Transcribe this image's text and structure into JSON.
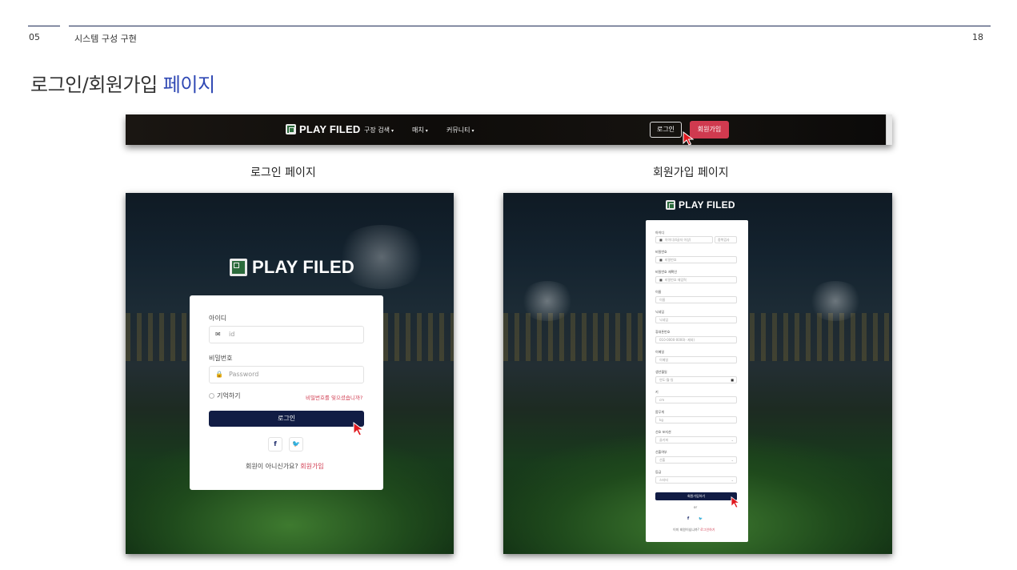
{
  "header": {
    "section_number": "05",
    "section_title": "시스템 구성 구현",
    "page_number": "18"
  },
  "title": {
    "main": "로그인/회원가입",
    "accent": "페이지"
  },
  "navbar": {
    "brand": "PLAY FILED",
    "items": [
      {
        "label": "구장 검색"
      },
      {
        "label": "매치"
      },
      {
        "label": "커뮤니티"
      }
    ],
    "login_label": "로그인",
    "signup_label": "회원가입"
  },
  "captions": {
    "login": "로그인 페이지",
    "signup": "회원가입 페이지"
  },
  "login_page": {
    "brand": "PLAY FILED",
    "id_label": "아이디",
    "id_placeholder": "id",
    "password_label": "비밀번호",
    "password_placeholder": "Password",
    "remember_label": "기억하기",
    "forgot_link": "비밀번호를 잊으셨습니까?",
    "submit_label": "로그인",
    "social": {
      "facebook": "f",
      "twitter": "🐦"
    },
    "no_account_text": "회원이 아니신가요?",
    "signup_link": "회원가입"
  },
  "signup_page": {
    "brand": "PLAY FILED",
    "fields": [
      {
        "label": "아이디",
        "placeholder": "아이디(4글자 이상)",
        "side_button": "중복검사"
      },
      {
        "label": "비밀번호",
        "placeholder": "비밀번호"
      },
      {
        "label": "비밀번호 재확인",
        "placeholder": "비밀번호 재입력"
      },
      {
        "label": "이름",
        "placeholder": "이름"
      },
      {
        "label": "닉네임",
        "placeholder": "닉네임"
      },
      {
        "label": "휴대폰번호",
        "placeholder": "010-0000-0000(- 제외)"
      },
      {
        "label": "이메일",
        "placeholder": "이메일"
      },
      {
        "label": "생년월일",
        "placeholder": "연도-월-일"
      },
      {
        "label": "키",
        "placeholder": "cm"
      },
      {
        "label": "몸무게",
        "placeholder": "kg"
      },
      {
        "label": "선호 포지션",
        "placeholder": "골키퍼"
      },
      {
        "label": "선출여부",
        "placeholder": "선출"
      },
      {
        "label": "등급",
        "placeholder": "스타터"
      }
    ],
    "submit_label": "회원가입하기",
    "or_text": "or",
    "social": {
      "facebook": "f",
      "twitter": "🐦"
    },
    "footer_text": "이미 회원이십니까?",
    "login_link": "로그인하기"
  }
}
